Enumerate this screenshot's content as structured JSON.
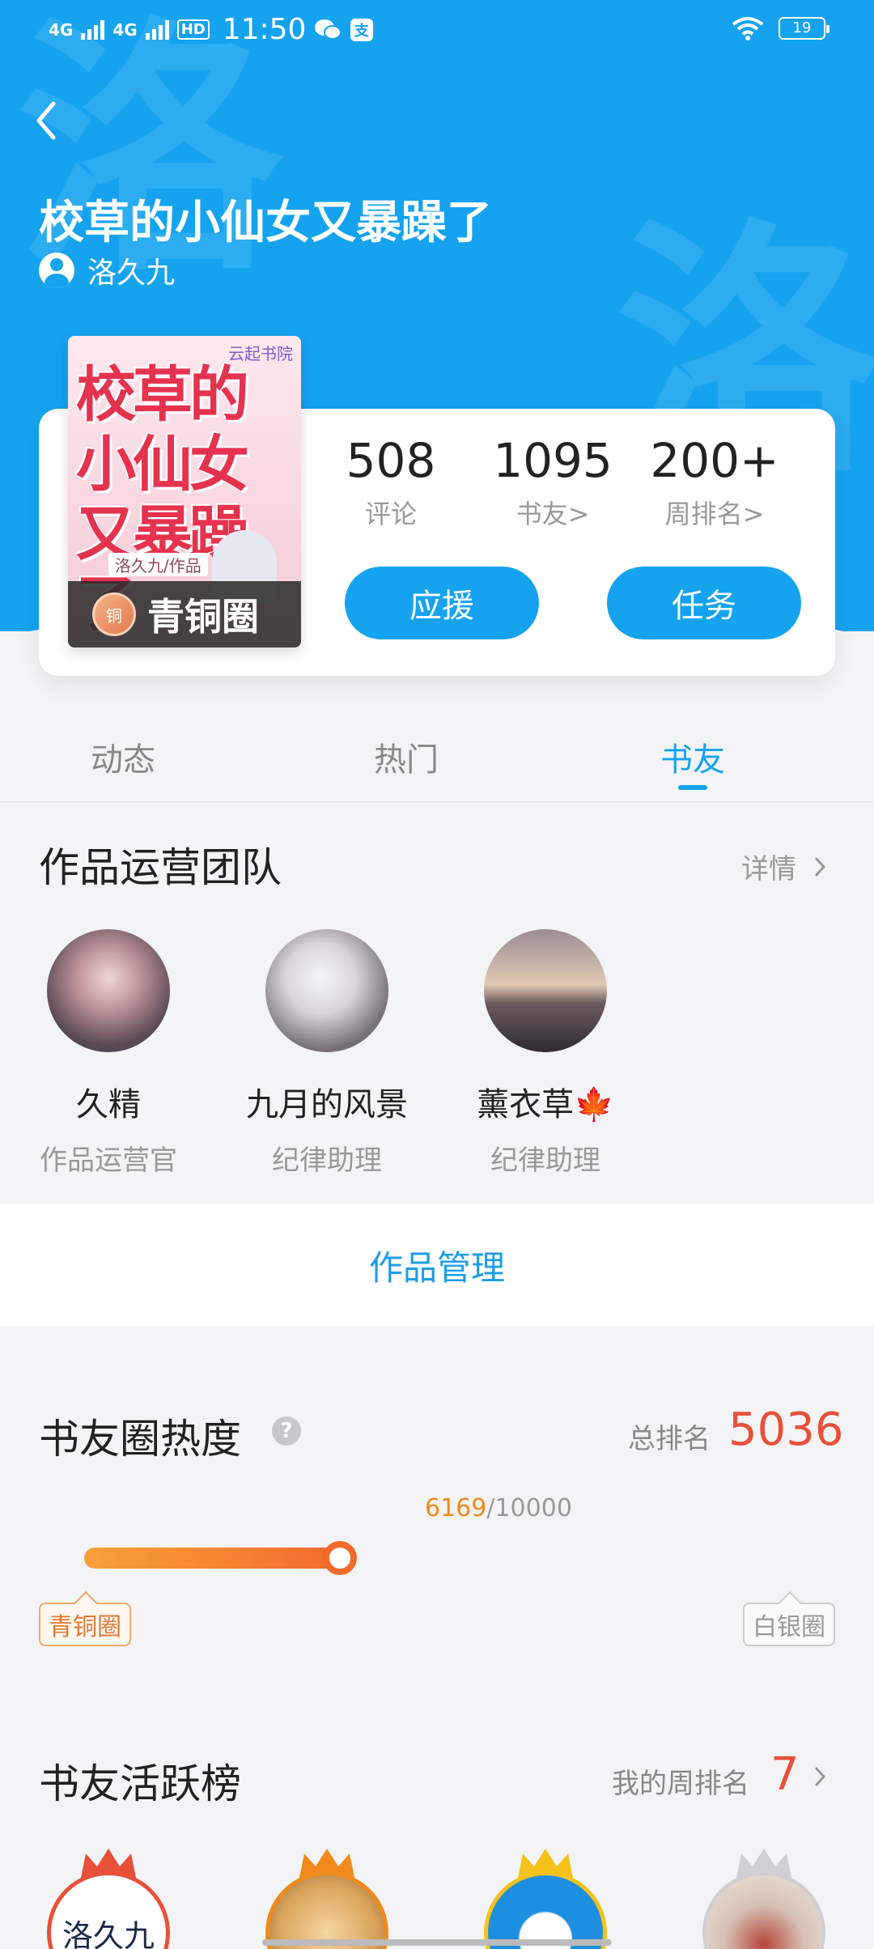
{
  "status_bar": {
    "signal1": "4G",
    "signal2": "4G",
    "hd": "HD",
    "time": "11:50",
    "battery": "19"
  },
  "header": {
    "back_icon": "back-icon",
    "title": "校草的小仙女又暴躁了",
    "author": "洛久九",
    "watermark_char": "洛"
  },
  "book": {
    "cover_publisher": "云起书院",
    "cover_title": "校草的小仙女又暴躁了",
    "cover_author_line": "洛久九/作品",
    "circle_badge": "铜",
    "circle_level": "青铜圈"
  },
  "stats": [
    {
      "value": "508",
      "label": "评论"
    },
    {
      "value": "1095",
      "label": "书友>"
    },
    {
      "value": "200+",
      "label": "周排名>"
    }
  ],
  "actions": {
    "support": "应援",
    "tasks": "任务"
  },
  "tabs": [
    {
      "label": "动态",
      "active": false
    },
    {
      "label": "热门",
      "active": false
    },
    {
      "label": "书友",
      "active": true
    }
  ],
  "team": {
    "title": "作品运营团队",
    "detail": "详情",
    "members": [
      {
        "name": "久精",
        "role": "作品运营官"
      },
      {
        "name": "九月的风景",
        "role": "纪律助理"
      },
      {
        "name": "薰衣草🍁",
        "role": "纪律助理"
      }
    ]
  },
  "manage": {
    "label": "作品管理"
  },
  "heat": {
    "title": "书友圈热度",
    "help": "?",
    "rank_label": "总排名",
    "rank_value": "5036",
    "current": "6169",
    "separator_max": "/10000",
    "progress_fraction": 0.6169,
    "current_level": "青铜圈",
    "next_level": "白银圈"
  },
  "active_board": {
    "title": "书友活跃榜",
    "my_rank_label": "我的周排名",
    "my_rank_value": "7",
    "first_avatar_text": "洛久九"
  },
  "colors": {
    "brand_blue": "#15a3f0",
    "rank_red": "#e8503a",
    "progress_orange": "#f26b2c"
  }
}
